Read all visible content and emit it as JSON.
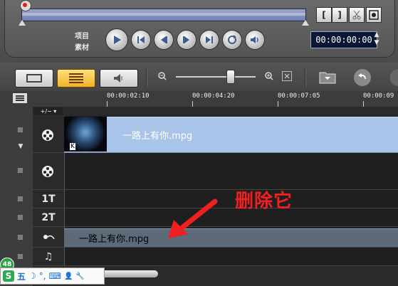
{
  "preview": {
    "label_project": "项目",
    "label_clip": "素材",
    "timecode": "00:00:00:00",
    "trim_buttons": [
      "[",
      "]"
    ],
    "controls": [
      "play-icon",
      "go-start-icon",
      "prev-frame-icon",
      "next-frame-icon",
      "go-end-icon",
      "repeat-icon",
      "volume-icon"
    ]
  },
  "toolbar": {
    "views": [
      "storyboard-view",
      "timeline-view",
      "audio-view"
    ],
    "active_view": "timeline-view",
    "zoom_minus": "−",
    "zoom_plus": "+",
    "zoom_level": 0.75
  },
  "ruler": {
    "ticks": [
      "00:00:02:10",
      "00:00:04:20",
      "00:00:07:05",
      "00:00:09"
    ]
  },
  "timeline": {
    "add_remove": "+/− ▾",
    "tracks": [
      {
        "icon": "video-track-icon",
        "label": ""
      },
      {
        "icon": "overlay-track-icon",
        "label": ""
      },
      {
        "icon": "title-track-icon",
        "label": "1T"
      },
      {
        "icon": "title-track-icon",
        "label": "2T"
      },
      {
        "icon": "voice-track-icon",
        "label": ""
      },
      {
        "icon": "music-track-icon",
        "label": "♫"
      }
    ],
    "video_clip_name": "一路上有你.mpg",
    "audio_clip_name": "一路上有你.mpg"
  },
  "annotation": {
    "text": "删除它",
    "color": "#f02020"
  },
  "ime": {
    "badge": "48",
    "logo": "S",
    "mode": "五",
    "items": [
      "☽",
      "°,",
      "⌨",
      "👤",
      "🔧"
    ]
  },
  "colors": {
    "video_clip": "#a8c4e8",
    "audio_clip": "#5d6a7a",
    "timecode_bg": "#0b1636",
    "active_view": "#f0b02a"
  }
}
